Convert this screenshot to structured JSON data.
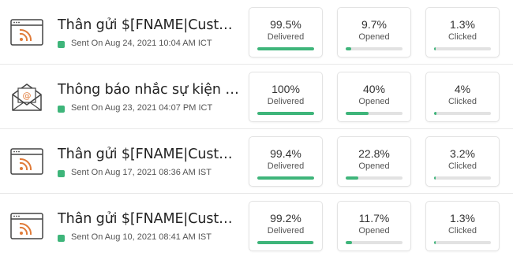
{
  "campaigns": [
    {
      "icon": "rss-icon",
      "title": "Thân gửi $[FNAME|Customer] ...",
      "sent": "Sent On Aug 24, 2021 10:04 AM ICT",
      "delivered": {
        "value": "99.5%",
        "label": "Delivered",
        "fraction": 0.995
      },
      "opened": {
        "value": "9.7%",
        "label": "Opened",
        "fraction": 0.097
      },
      "clicked": {
        "value": "1.3%",
        "label": "Clicked",
        "fraction": 0.013
      }
    },
    {
      "icon": "email-envelope-icon",
      "title": "Thông báo nhắc sự kiện webinar",
      "sent": "Sent On Aug 23, 2021 04:07 PM ICT",
      "delivered": {
        "value": "100%",
        "label": "Delivered",
        "fraction": 1.0
      },
      "opened": {
        "value": "40%",
        "label": "Opened",
        "fraction": 0.4
      },
      "clicked": {
        "value": "4%",
        "label": "Clicked",
        "fraction": 0.04
      }
    },
    {
      "icon": "rss-icon",
      "title": "Thân gửi $[FNAME|Customer] ...",
      "sent": "Sent On Aug 17, 2021 08:36 AM IST",
      "delivered": {
        "value": "99.4%",
        "label": "Delivered",
        "fraction": 0.994
      },
      "opened": {
        "value": "22.8%",
        "label": "Opened",
        "fraction": 0.228
      },
      "clicked": {
        "value": "3.2%",
        "label": "Clicked",
        "fraction": 0.032
      }
    },
    {
      "icon": "rss-icon",
      "title": "Thân gửi $[FNAME|Customer] ...",
      "sent": "Sent On Aug 10, 2021 08:41 AM IST",
      "delivered": {
        "value": "99.2%",
        "label": "Delivered",
        "fraction": 0.992
      },
      "opened": {
        "value": "11.7%",
        "label": "Opened",
        "fraction": 0.117
      },
      "clicked": {
        "value": "1.3%",
        "label": "Clicked",
        "fraction": 0.013
      }
    }
  ],
  "colors": {
    "status": "#3eb57a",
    "bar_fill": "#3eb57a",
    "bar_track": "#e2e2e2",
    "icon_accent": "#e07b39"
  }
}
